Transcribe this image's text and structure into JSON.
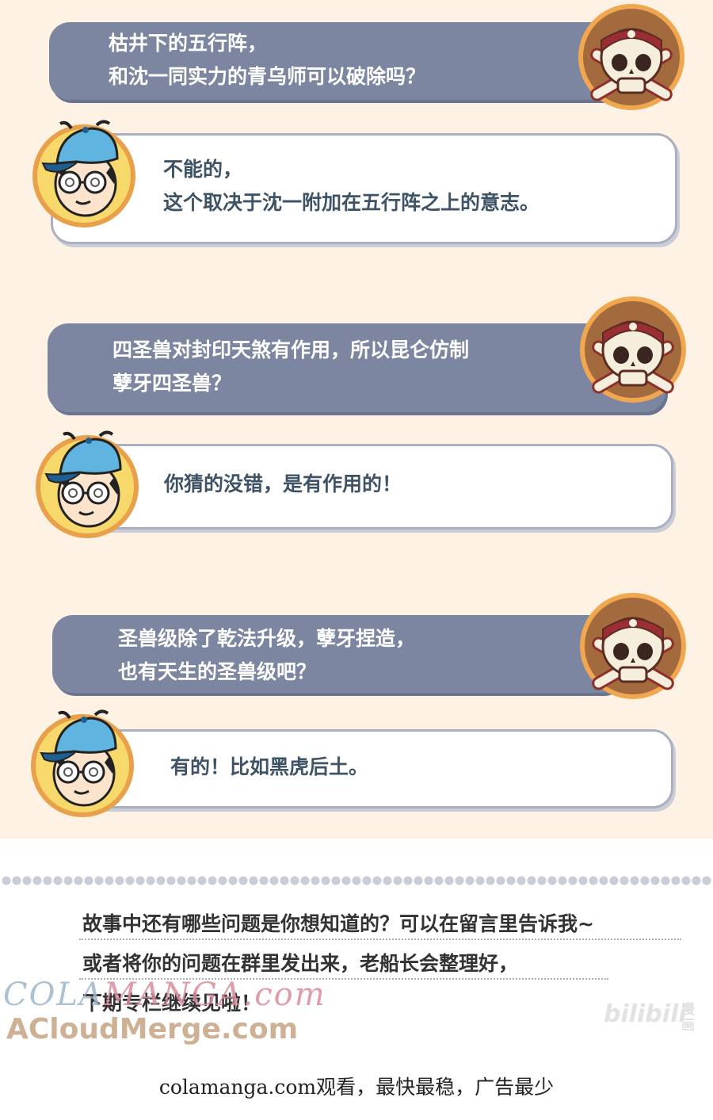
{
  "qa": [
    {
      "question": [
        "枯井下的五行阵，",
        "和沈一同实力的青乌师可以破除吗？"
      ],
      "answer": [
        "不能的，",
        "这个取决于沈一附加在五行阵之上的意志。"
      ]
    },
    {
      "question": [
        "四圣兽对封印天煞有作用，所以昆仑仿制",
        "孽牙四圣兽？"
      ],
      "answer": [
        "你猜的没错，是有作用的！"
      ]
    },
    {
      "question": [
        "圣兽级除了乾法升级，孽牙捏造，",
        "也有天生的圣兽级吧？"
      ],
      "answer": [
        "有的！比如黑虎后土。"
      ]
    }
  ],
  "outro": [
    "故事中还有哪些问题是你想知道的？可以在留言里告诉我~",
    "或者将你的问题在群里发出来，老船长会整理好，",
    "下期专栏继续见啦！"
  ],
  "watermark": {
    "line1_a": "COLA",
    "line1_b": "MANGA.com",
    "line2": "ACloudMerge.com"
  },
  "bilibili": {
    "logo": "bilibili",
    "manhua": "漫画"
  },
  "footer": "colamanga.com观看，最快最稳，广告最少",
  "colors": {
    "background": "#fdf2e3",
    "question_bubble": "#7d86a1",
    "answer_text": "#3f5366",
    "avatar_ring": "#e9a04a"
  },
  "icons": {
    "questioner": "pirate-skull-icon",
    "answerer": "boy-with-cap-icon"
  }
}
